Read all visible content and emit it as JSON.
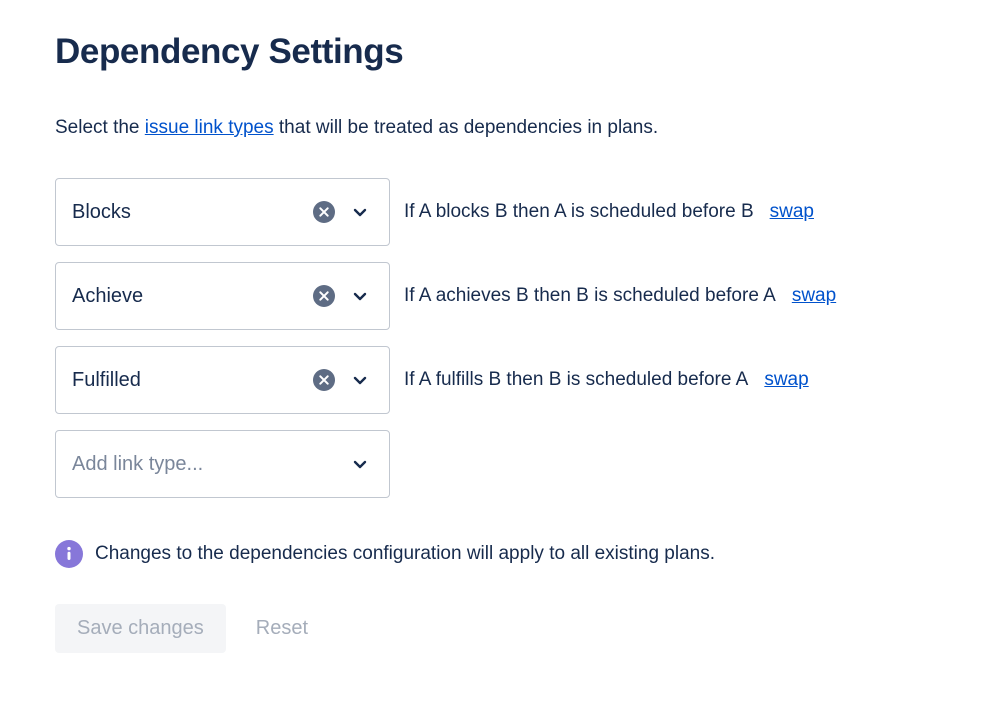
{
  "page": {
    "title": "Dependency Settings",
    "intro_prefix": "Select the ",
    "intro_link": "issue link types",
    "intro_suffix": " that will be treated as dependencies in plans."
  },
  "link_rows": [
    {
      "value": "Blocks",
      "rule": "If A blocks B then A is scheduled before B",
      "swap_label": "swap",
      "clear_icon": "clear-circle-icon",
      "chevron_icon": "chevron-down-icon"
    },
    {
      "value": "Achieve",
      "rule": "If A achieves B then B is scheduled before A",
      "swap_label": "swap",
      "clear_icon": "clear-circle-icon",
      "chevron_icon": "chevron-down-icon"
    },
    {
      "value": "Fulfilled",
      "rule": "If A fulfills B then B is scheduled before A",
      "swap_label": "swap",
      "clear_icon": "clear-circle-icon",
      "chevron_icon": "chevron-down-icon"
    }
  ],
  "add_row": {
    "placeholder": "Add link type...",
    "chevron_icon": "chevron-down-icon"
  },
  "note": {
    "icon": "info-icon",
    "text": "Changes to the dependencies configuration will apply to all existing plans."
  },
  "actions": {
    "save_label": "Save changes",
    "reset_label": "Reset"
  },
  "colors": {
    "heading": "#172B4D",
    "link": "#0052CC",
    "border": "#C1C7D0",
    "placeholder": "#7A869A",
    "clear_icon": "#5E6C84",
    "info_icon": "#8777D9",
    "disabled_button_bg": "#F4F5F7",
    "disabled_button_text": "#A5ADBA"
  }
}
